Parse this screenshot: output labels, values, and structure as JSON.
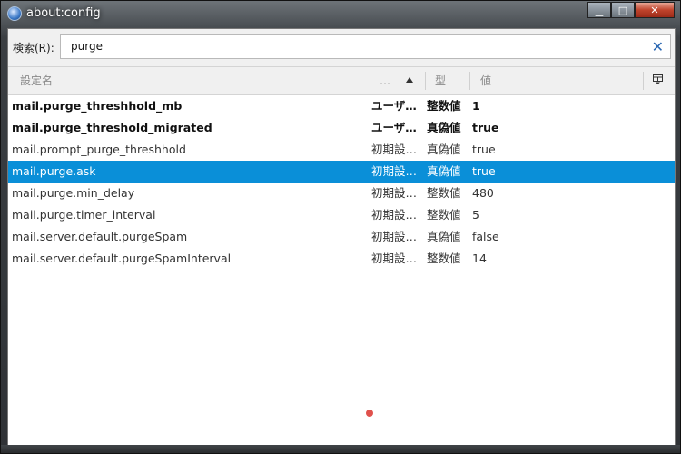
{
  "window": {
    "title": "about:config"
  },
  "search": {
    "label": "検索(R):",
    "value": "purge"
  },
  "columns": {
    "name": "設定名",
    "status": "…",
    "type": "型",
    "value": "値"
  },
  "rows": [
    {
      "name": "mail.purge_threshhold_mb",
      "status": "ユーザ…",
      "type": "整数値",
      "value": "1",
      "modified": true,
      "selected": false
    },
    {
      "name": "mail.purge_threshold_migrated",
      "status": "ユーザ…",
      "type": "真偽値",
      "value": "true",
      "modified": true,
      "selected": false
    },
    {
      "name": "mail.prompt_purge_threshhold",
      "status": "初期設…",
      "type": "真偽値",
      "value": "true",
      "modified": false,
      "selected": false
    },
    {
      "name": "mail.purge.ask",
      "status": "初期設…",
      "type": "真偽値",
      "value": "true",
      "modified": false,
      "selected": true
    },
    {
      "name": "mail.purge.min_delay",
      "status": "初期設…",
      "type": "整数値",
      "value": "480",
      "modified": false,
      "selected": false
    },
    {
      "name": "mail.purge.timer_interval",
      "status": "初期設…",
      "type": "整数値",
      "value": "5",
      "modified": false,
      "selected": false
    },
    {
      "name": "mail.server.default.purgeSpam",
      "status": "初期設…",
      "type": "真偽値",
      "value": "false",
      "modified": false,
      "selected": false
    },
    {
      "name": "mail.server.default.purgeSpamInterval",
      "status": "初期設…",
      "type": "整数値",
      "value": "14",
      "modified": false,
      "selected": false
    }
  ],
  "icons": {
    "app": "thunderbird-icon",
    "clear": "close-icon",
    "sort": "sort-ascending-icon",
    "picker": "column-picker-icon"
  },
  "colors": {
    "selection": "#0a8fd8",
    "indicator": "#e0514c"
  }
}
